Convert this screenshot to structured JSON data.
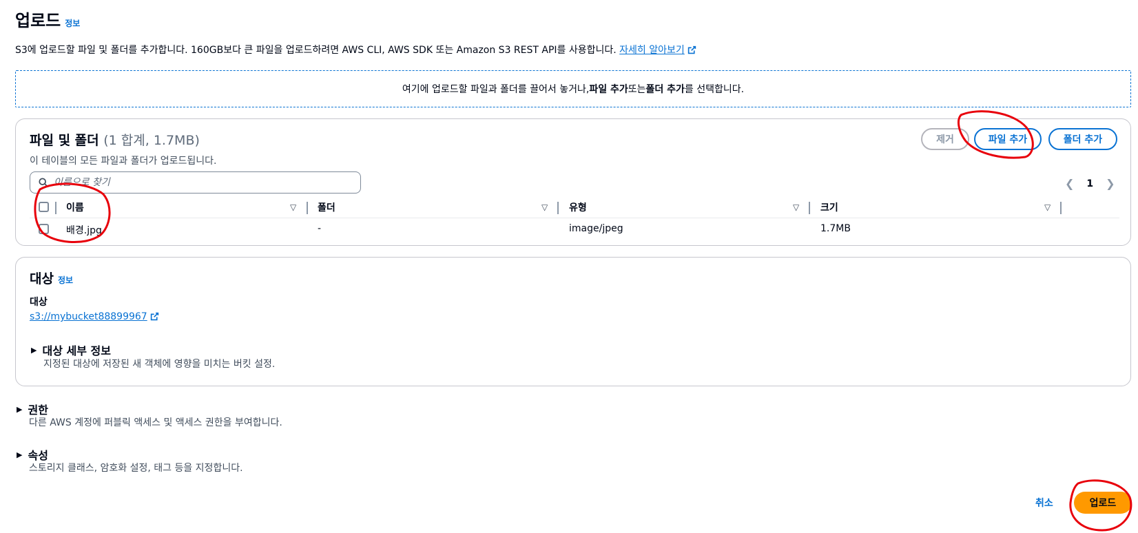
{
  "header": {
    "title": "업로드",
    "info": "정보"
  },
  "description": {
    "text": "S3에 업로드할 파일 및 폴더를 추가합니다. 160GB보다 큰 파일을 업로드하려면 AWS CLI, AWS SDK 또는 Amazon S3 REST API를 사용합니다. ",
    "link": "자세히 알아보기"
  },
  "dropzone": {
    "prefix": "여기에 업로드할 파일과 폴더를 끌어서 놓거나, ",
    "add_files": "파일 추가",
    "middle": " 또는 ",
    "add_folder": "폴더 추가",
    "suffix": "를 선택합니다."
  },
  "files": {
    "title": "파일 및 폴더",
    "count": "(1 합계, 1.7MB)",
    "subtitle": "이 테이블의 모든 파일과 폴더가 업로드됩니다.",
    "remove_label": "제거",
    "add_files_label": "파일 추가",
    "add_folder_label": "폴더 추가",
    "search_placeholder": "이름으로 찾기",
    "page": "1",
    "columns": [
      "이름",
      "폴더",
      "유형",
      "크기"
    ],
    "rows": [
      {
        "name": "배경.jpg",
        "folder": "-",
        "type": "image/jpeg",
        "size": "1.7MB"
      }
    ]
  },
  "destination": {
    "title": "대상",
    "info": "정보",
    "label": "대상",
    "link": "s3://mybucket88899967",
    "details_title": "대상 세부 정보",
    "details_desc": "지정된 대상에 저장된 새 객체에 영향을 미치는 버킷 설정."
  },
  "permissions": {
    "title": "권한",
    "desc": "다른 AWS 계정에 퍼블릭 액세스 및 액세스 권한을 부여합니다."
  },
  "properties": {
    "title": "속성",
    "desc": "스토리지 클래스, 암호화 설정, 태그 등을 지정합니다."
  },
  "footer": {
    "cancel": "취소",
    "upload": "업로드"
  },
  "colors": {
    "link": "#0972d3",
    "primary": "#ff9900",
    "annotation": "#e8000b"
  }
}
